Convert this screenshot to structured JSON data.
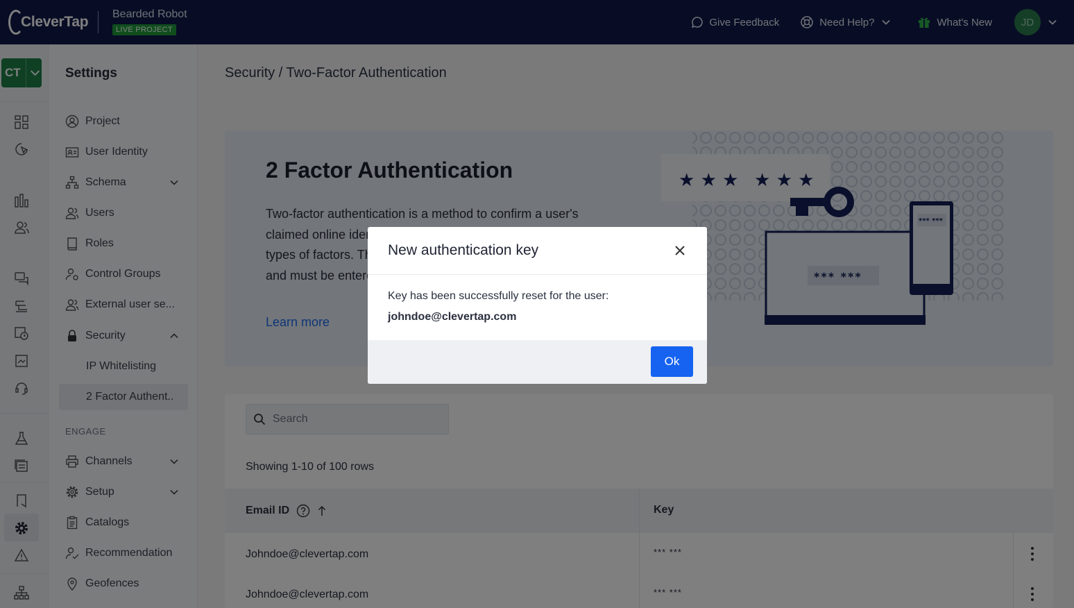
{
  "header": {
    "brand": "CleverTap",
    "project_name": "Bearded Robot",
    "project_badge": "LIVE PROJECT",
    "actions": {
      "feedback": "Give Feedback",
      "help": "Need Help?",
      "whats_new": "What's New"
    },
    "avatar_initials": "JD"
  },
  "rail": {
    "account_initials": "CT"
  },
  "settings": {
    "title": "Settings",
    "items": [
      {
        "label": "Project",
        "icon": "user-circle-icon"
      },
      {
        "label": "User Identity",
        "icon": "id-card-icon"
      },
      {
        "label": "Schema",
        "icon": "hierarchy-icon"
      },
      {
        "label": "Users",
        "icon": "users-icon"
      },
      {
        "label": "Roles",
        "icon": "book-icon"
      },
      {
        "label": "Control Groups",
        "icon": "user-gear-icon"
      },
      {
        "label": "External user se...",
        "icon": "users-icon"
      },
      {
        "label": "Security",
        "icon": "lock-icon"
      }
    ],
    "security_sub": [
      "IP Whitelisting",
      "2 Factor Authent.."
    ],
    "engage_label": "ENGAGE",
    "engage_items": [
      {
        "label": "Channels",
        "icon": "printer-icon"
      },
      {
        "label": "Setup",
        "icon": "gear-icon"
      },
      {
        "label": "Catalogs",
        "icon": "clipboard-icon"
      },
      {
        "label": "Recommendation",
        "icon": "user-check-icon"
      },
      {
        "label": "Geofences",
        "icon": "location-pin-icon"
      }
    ]
  },
  "main": {
    "breadcrumb": "Security / Two-Factor Authentication",
    "hero": {
      "title": "2 Factor Authentication",
      "body": "Two-factor authentication is a method to confirm a user's claimed online identity by using a combination of two different types of factors. The 2FA key is considered as the second factor and must be entered alongwith the password.",
      "link": "Learn more",
      "art_pin_left": "★ ★ ★",
      "art_pin_right": "★ ★ ★",
      "art_screen_pin": "*** ***",
      "art_phone_pin": "*** ***"
    },
    "table": {
      "search_placeholder": "Search",
      "showing": "Showing 1-10 of 100 rows",
      "col_email": "Email ID",
      "col_key": "Key",
      "rows": [
        {
          "email": "Johndoe@clevertap.com",
          "key": "*** ***"
        },
        {
          "email": "Johndoe@clevertap.com",
          "key": "*** ***"
        }
      ]
    }
  },
  "modal": {
    "title": "New authentication key",
    "message": "Key has been successfully reset for the user:",
    "email": "johndoe@clevertap.com",
    "ok_label": "Ok"
  }
}
